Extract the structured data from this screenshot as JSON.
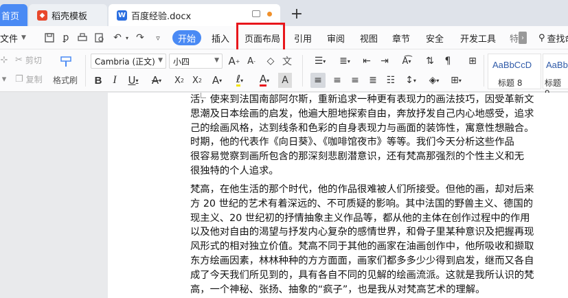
{
  "tabs": {
    "home": "首页",
    "template": "稻壳模板",
    "document": "百度经验.docx",
    "new_tab": "+"
  },
  "menu": {
    "file": "文件",
    "items": [
      "开始",
      "插入",
      "页面布局",
      "引用",
      "审阅",
      "视图",
      "章节",
      "安全",
      "开发工具",
      "特"
    ],
    "search": "查找命"
  },
  "ribbon": {
    "cut": "剪切",
    "copy": "复制",
    "format_painter": "格式刷",
    "font_name": "Cambria (正文)",
    "font_size": "小四",
    "styles": [
      {
        "preview": "AaBbCcD",
        "name": "标题 8"
      },
      {
        "preview": "AaBbCcD",
        "name": "标题 9"
      }
    ]
  },
  "document": {
    "paragraph1": [
      "活，使来到法国南部阿尔斯，重新追求一种更有表现力的画法技巧，因受革新文",
      "思潮及日本绘画的启发，他遍大胆地探索自由，奔放抒发自己内心地感受，追求",
      "己的绘画风格，达到线条和色彩的自身表现力与画面的装饰性，寓意性想融合。",
      "时期，他的代表作《向日葵》、《咖啡馆夜市》等等。我们今天分析这些作品",
      "很容易觉察到画所包含的那深刻悲剧潜意识，还有梵高那强烈的个性主义和无",
      "很独特的个人追求。"
    ],
    "paragraph2": [
      "梵高，在他生活的那个时代，他的作品很难被人们所接受。但他的画，却对后来",
      "方 20 世纪的艺术有着深远的、不可质疑的影响。其中法国的野兽主义、德国的",
      "现主义、20 世纪初的抒情抽象主义作品等，都从他的主体在创作过程中的作用",
      "以及他对自由的渴望与抒发内心复杂的感情世界，和骨子里某种意识及把握再现",
      "风形式的相对独立价值。梵高不同于其他的画家在油画创作中，他所吸收和撷取",
      "东方绘画因素，林林种种的方方面面，画家们都多多少少得到启发，继而又各自",
      "成了今天我们所见到的，具有各自不同的见解的绘画流派。这就是我所认识的梵",
      "高，一个神秘、张扬、抽象的“疯子”，也是我从对梵高艺术的理解。"
    ]
  },
  "colors": {
    "accent": "#4a8af4",
    "highlight": "#e8161b"
  }
}
